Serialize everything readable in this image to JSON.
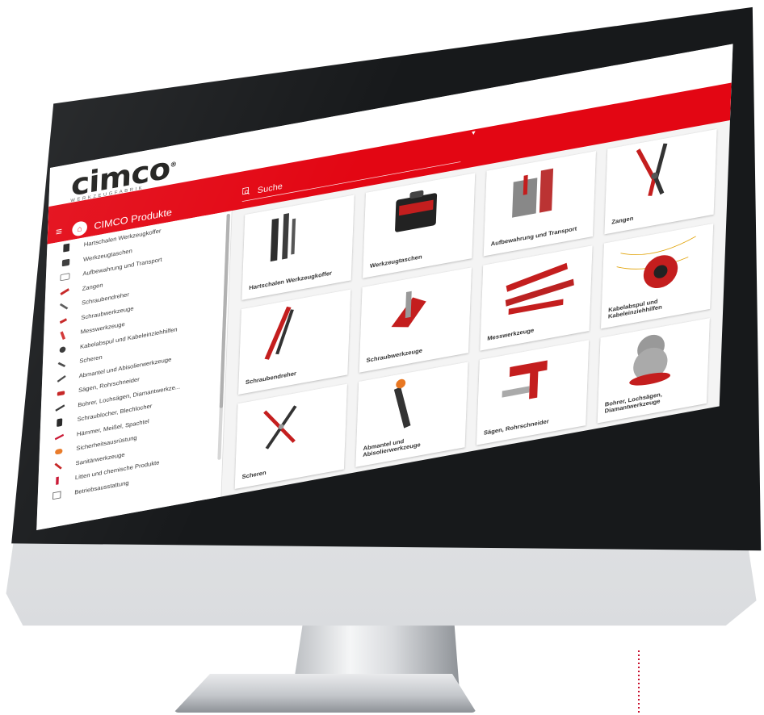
{
  "browser": {
    "url": "www.cimco.de"
  },
  "logo": {
    "text": "cimco",
    "registered": "®",
    "subtitle": "WERKZEUGFABRIK"
  },
  "header": {
    "menu_title": "CIMCO Produkte",
    "search_placeholder": "Suche",
    "icons": [
      "youtube-icon",
      "heart-icon",
      "document-icon",
      "card-icon"
    ]
  },
  "sidebar": {
    "items": [
      {
        "label": "Hartschalen Werkzeugkoffer",
        "icon": "case-icon"
      },
      {
        "label": "Werkzeugtaschen",
        "icon": "bag-icon"
      },
      {
        "label": "Aufbewahrung und Transport",
        "icon": "trolley-icon"
      },
      {
        "label": "Zangen",
        "icon": "pliers-icon"
      },
      {
        "label": "Schraubendreher",
        "icon": "screwdriver-icon"
      },
      {
        "label": "Schraubwerkzeuge",
        "icon": "wrench-icon"
      },
      {
        "label": "Messwerkzeuge",
        "icon": "ruler-icon"
      },
      {
        "label": "Kabelabspul und Kabeleinziehhilfen",
        "icon": "cable-icon"
      },
      {
        "label": "Scheren",
        "icon": "scissors-icon"
      },
      {
        "label": "Abmantel und Abisolierwerkzeuge",
        "icon": "stripper-icon"
      },
      {
        "label": "Sägen, Rohrschneider",
        "icon": "saw-icon"
      },
      {
        "label": "Bohrer, Lochsägen, Diamantwerkze...",
        "icon": "drill-icon"
      },
      {
        "label": "Schraublocher, Blechlocher",
        "icon": "punch-icon"
      },
      {
        "label": "Hämmer, Meißel, Spachtel",
        "icon": "hammer-icon"
      },
      {
        "label": "Sicherheitsausrüstung",
        "icon": "safety-icon"
      },
      {
        "label": "Sanitärwerkzeuge",
        "icon": "sanitary-icon"
      },
      {
        "label": "Litten und chemische Produkte",
        "icon": "chemical-icon"
      },
      {
        "label": "Betriebsausstattung",
        "icon": "equipment-icon"
      }
    ]
  },
  "products": [
    {
      "label": "Hartschalen Werkzeugkoffer"
    },
    {
      "label": "Werkzeugtaschen"
    },
    {
      "label": "Aufbewahrung und Transport"
    },
    {
      "label": "Zangen"
    },
    {
      "label": "Schraubendreher"
    },
    {
      "label": "Schraubwerkzeuge"
    },
    {
      "label": "Messwerkzeuge"
    },
    {
      "label": "Kabelabspul und Kabeleinziehhilfen"
    },
    {
      "label": "Scheren"
    },
    {
      "label": "Abmantel und Abisolierwerkzeuge"
    },
    {
      "label": "Sägen, Rohrschneider"
    },
    {
      "label": "Bohrer, Lochsägen, Diamantwerkzeuge"
    }
  ],
  "colors": {
    "brand_red": "#e30613",
    "bezel": "#17191b",
    "text": "#333333"
  }
}
